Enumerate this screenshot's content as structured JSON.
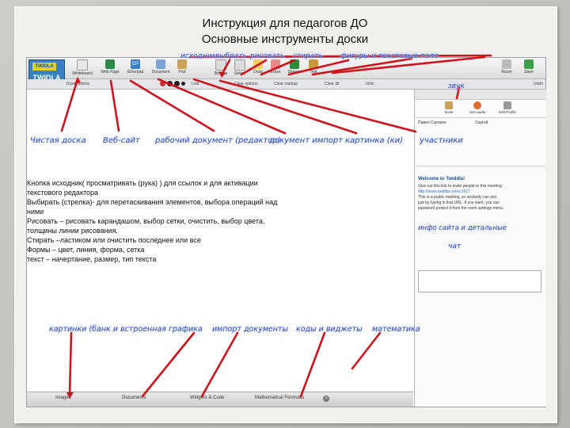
{
  "slide": {
    "title_line1": "Инструкция для педагогов ДО",
    "title_line2": "Основные инструменты доски"
  },
  "app": {
    "logo_top": "TWIDLA",
    "logo_main": "TWIDLA",
    "toolbar_items": [
      "Whiteboard",
      "Web Page",
      "Etherpad",
      "Document",
      "Prof",
      "Browse",
      "Select",
      "Draw",
      "Erase",
      "Shapes",
      "Text"
    ],
    "toolbar_right": [
      "Room",
      "Save"
    ],
    "options": {
      "draw_options": "Draw options",
      "line": "Line",
      "clear_options": "Clear options",
      "clear_markup": "Clear markup",
      "clear_all": "Clear all",
      "grid": "Grid:"
    },
    "undo": "Undo",
    "side_panel": {
      "buttons": [
        "Invite",
        "Join audio",
        "Edit Profile"
      ],
      "users": [
        "Павел Сорокин",
        "Сергей"
      ],
      "welcome_title": "Welcome to Twiddla!",
      "welcome_lines": [
        "Give out this link to invite people to this meeting:",
        "http://www.twiddla.com/c1617",
        "This is a public meeting, so anybody can join",
        "just by typing in that URL. If you want, you can",
        "password protect it from the room settings menu."
      ]
    },
    "bottom_tabs": [
      "Images",
      "Documents",
      "Widgets & Code",
      "Mathematical Formulas"
    ]
  },
  "annotations": {
    "top_left": "исходник",
    "top_select": "выбрать",
    "top_draw": "рисовать",
    "top_erase": "стирать",
    "top_rest": "фигуры   и  текстовые  поля",
    "clean_board": "Чистая доска",
    "web_site": "Веб-сайт",
    "working_doc": "рабочий документ (редактор)",
    "doc_import": "документ импорт",
    "picture": "картинка (ки)",
    "participants": "участники",
    "sound": "звук",
    "chat_info": "инфо   сайта и     детальные",
    "chat": "чат",
    "img_bank": "картинки (банк и  встроенная  графика",
    "doc_import2": "импорт документы",
    "codes": "коды и виджеты",
    "math": "математика"
  },
  "body_lines": [
    "Кнопка исходник( просматривать (рука) ) для ссылок и для активации",
    "текстового редактора",
    "Выбирать (стрелка)- для перетаскивания элементов, выбора операций над",
    "ними",
    "Рисовать – рисовать карандашом, выбор  сетки, очистить, выбор цвета,",
    "толщины линии рисования.",
    "Стирать –ластиком или очистить последнее или все",
    "Формы – цвет, линия, форма, сетка",
    "текст – начертание, размер, тип текста"
  ],
  "colors": {
    "annotation_blue": "#2d49b8",
    "arrow_red": "#d0141d",
    "logo_blue": "#3a7fc4"
  }
}
